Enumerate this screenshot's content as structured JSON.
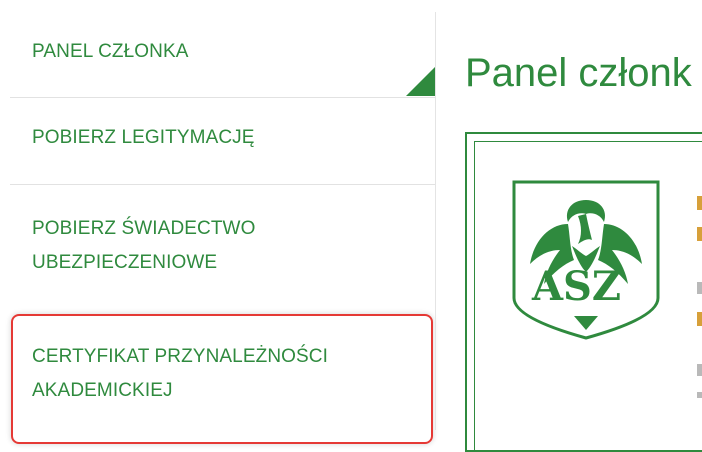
{
  "sidebar": {
    "items": [
      {
        "label": "PANEL CZŁONKA",
        "active": true
      },
      {
        "label": "POBIERZ LEGITYMACJĘ"
      },
      {
        "label_line1": "POBIERZ ŚWIADECTWO",
        "label_line2": "UBEZPIECZENIOWE"
      },
      {
        "label_line1": "CERTYFIKAT PRZYNALEŻNOŚCI",
        "label_line2": "AKADEMICKIEJ",
        "highlighted": true
      }
    ]
  },
  "main": {
    "title": "Panel członk",
    "card": {
      "logo_text": "ASZ"
    }
  },
  "colors": {
    "brand_green": "#2f8a3e",
    "highlight_red": "#e53935",
    "accent_gold": "#d7a03a"
  }
}
